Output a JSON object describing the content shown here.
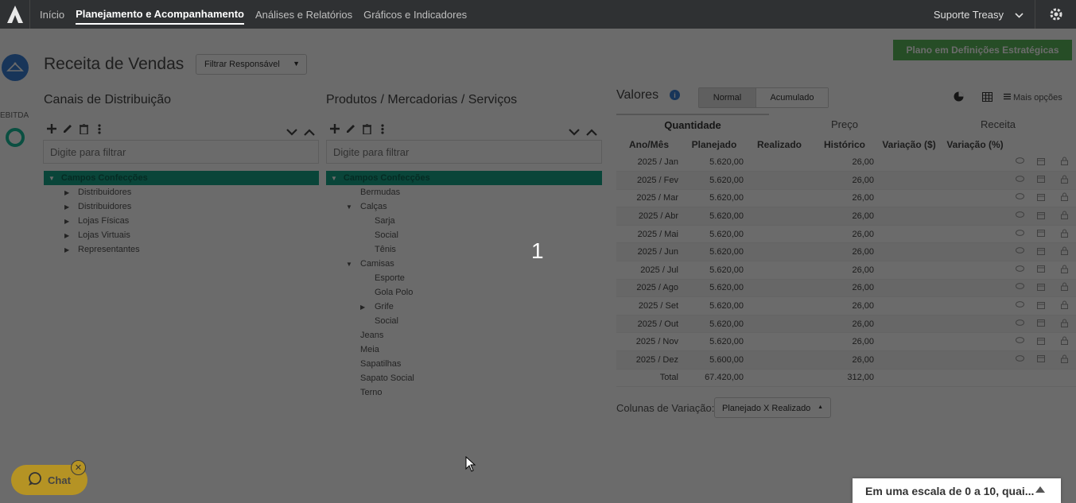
{
  "nav": {
    "items": [
      "Início",
      "Planejamento e Acompanhamento",
      "Análises e Relatórios",
      "Gráficos e Indicadores"
    ],
    "active_index": 1,
    "user": "Suporte Treasy"
  },
  "rail": {
    "label": "EBITDA"
  },
  "page": {
    "title": "Receita de Vendas",
    "filter_select": "Filtrar Responsável",
    "status_button": "Plano em Definições Estratégicas"
  },
  "channels": {
    "title": "Canais de Distribuição",
    "filter_placeholder": "Digite para filtrar",
    "root": "Campos Confecções",
    "items": [
      "Distribuidores",
      "Distribuidores",
      "Lojas Físicas",
      "Lojas Virtuais",
      "Representantes"
    ]
  },
  "products": {
    "title": "Produtos / Mercadorias / Serviços",
    "filter_placeholder": "Digite para filtrar",
    "root": "Campos Confecções",
    "items": [
      {
        "label": "Bermudas",
        "level": 1,
        "arrow": ""
      },
      {
        "label": "Calças",
        "level": 1,
        "arrow": "down"
      },
      {
        "label": "Sarja",
        "level": 2,
        "arrow": ""
      },
      {
        "label": "Social",
        "level": 2,
        "arrow": ""
      },
      {
        "label": "Tênis",
        "level": 2,
        "arrow": ""
      },
      {
        "label": "Camisas",
        "level": 1,
        "arrow": "down"
      },
      {
        "label": "Esporte",
        "level": 2,
        "arrow": ""
      },
      {
        "label": "Gola Polo",
        "level": 2,
        "arrow": ""
      },
      {
        "label": "Grife",
        "level": 2,
        "arrow": "right"
      },
      {
        "label": "Social",
        "level": 2,
        "arrow": ""
      },
      {
        "label": "Jeans",
        "level": 1,
        "arrow": ""
      },
      {
        "label": "Meia",
        "level": 1,
        "arrow": ""
      },
      {
        "label": "Sapatilhas",
        "level": 1,
        "arrow": ""
      },
      {
        "label": "Sapato Social",
        "level": 1,
        "arrow": ""
      },
      {
        "label": "Terno",
        "level": 1,
        "arrow": ""
      }
    ]
  },
  "valores": {
    "title": "Valores",
    "toggle_normal": "Normal",
    "toggle_acumulado": "Acumulado",
    "more_options": "Mais opções",
    "tabs": [
      "Quantidade",
      "Preço",
      "Receita"
    ],
    "columns": [
      "Ano/Mês",
      "Planejado",
      "Realizado",
      "Histórico",
      "Variação ($)",
      "Variação (%)"
    ],
    "rows": [
      {
        "month": "2025 / Jan",
        "planejado": "5.620,00",
        "realizado": "",
        "historico": "26,00"
      },
      {
        "month": "2025 / Fev",
        "planejado": "5.620,00",
        "realizado": "",
        "historico": "26,00"
      },
      {
        "month": "2025 / Mar",
        "planejado": "5.620,00",
        "realizado": "",
        "historico": "26,00"
      },
      {
        "month": "2025 / Abr",
        "planejado": "5.620,00",
        "realizado": "",
        "historico": "26,00"
      },
      {
        "month": "2025 / Mai",
        "planejado": "5.620,00",
        "realizado": "",
        "historico": "26,00"
      },
      {
        "month": "2025 / Jun",
        "planejado": "5.620,00",
        "realizado": "",
        "historico": "26,00"
      },
      {
        "month": "2025 / Jul",
        "planejado": "5.620,00",
        "realizado": "",
        "historico": "26,00"
      },
      {
        "month": "2025 / Ago",
        "planejado": "5.620,00",
        "realizado": "",
        "historico": "26,00"
      },
      {
        "month": "2025 / Set",
        "planejado": "5.620,00",
        "realizado": "",
        "historico": "26,00"
      },
      {
        "month": "2025 / Out",
        "planejado": "5.620,00",
        "realizado": "",
        "historico": "26,00"
      },
      {
        "month": "2025 / Nov",
        "planejado": "5.620,00",
        "realizado": "",
        "historico": "26,00"
      },
      {
        "month": "2025 / Dez",
        "planejado": "5.600,00",
        "realizado": "",
        "historico": "26,00"
      }
    ],
    "total_label": "Total",
    "total_planejado": "67.420,00",
    "total_historico": "312,00",
    "variation_label": "Colunas de Variação:",
    "variation_select": "Planejado X Realizado"
  },
  "overlay": {
    "step_number": "1"
  },
  "chat": {
    "label": "Chat"
  },
  "survey": {
    "text": "Em uma escala de 0 a 10, quai..."
  }
}
